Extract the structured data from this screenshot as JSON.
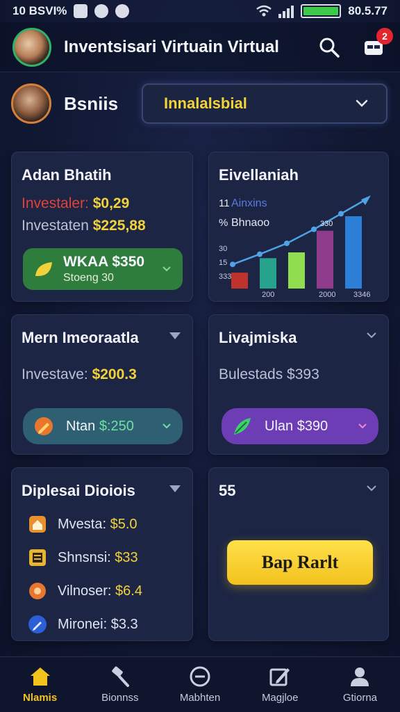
{
  "status_bar": {
    "left_text": "10 BSVI%",
    "time": "80.5.77"
  },
  "header": {
    "title": "Inventsisari Virtuain Virtual",
    "notification_count": "2"
  },
  "profile": {
    "name": "Bsniis",
    "dropdown_value": "Innalalsbial"
  },
  "card_investment": {
    "title": "Adan Bhatih",
    "line1_label": "Investaler:",
    "line1_value": "$0,29",
    "line2_label": "Investaten",
    "line2_value": "$225,88",
    "pill_main": "WKAA $350",
    "pill_sub": "Stoeng 30"
  },
  "card_chart": {
    "title": "Eivellaniah"
  },
  "chart_data": {
    "type": "bar",
    "title": "Eivellaniah",
    "legend": [
      "Ainxins",
      "Bhnaoo"
    ],
    "legend_prefixes": [
      "11",
      "%"
    ],
    "y_ticks": [
      "30",
      "15",
      "333"
    ],
    "x_ticks": [
      "200",
      "2000",
      "3346"
    ],
    "annotation": "330",
    "values": [
      22,
      42,
      50,
      80,
      100
    ],
    "colors": [
      "#c0322d",
      "#27a38d",
      "#90dd4f",
      "#8d3b8a",
      "#2c7fd6"
    ],
    "trend": [
      15,
      28,
      42,
      60,
      80,
      100
    ]
  },
  "card_mern": {
    "title": "Mern Imeoraatla",
    "line_label": "Investave:",
    "line_value": "$200.3",
    "pill_label": "Ntan",
    "pill_value": "$:250"
  },
  "card_liva": {
    "title": "Livajmiska",
    "line_text": "Bulestads $393",
    "pill_label": "Ulan $390"
  },
  "card_diplesai": {
    "title": "Diplesai Dioiois",
    "items": [
      {
        "label": "Mvesta:",
        "value": "$5.0",
        "icon": "house-icon",
        "color": "#e8912e"
      },
      {
        "label": "Shnsnsi:",
        "value": "$33",
        "icon": "document-icon",
        "color": "#e8b52e"
      },
      {
        "label": "Vilnoser:",
        "value": "$6.4",
        "icon": "piggy-bank-icon",
        "color": "#e8762e"
      },
      {
        "label": "Mironei:",
        "value": "$3.3",
        "icon": "pen-icon",
        "color": "#2a5fd6"
      }
    ]
  },
  "card_action": {
    "title": "55",
    "button_label": "Bap Rarlt"
  },
  "bottom_nav": {
    "items": [
      {
        "label": "Nlamis",
        "icon": "home-icon"
      },
      {
        "label": "Bionnss",
        "icon": "gavel-icon"
      },
      {
        "label": "Mabhten",
        "icon": "compass-icon"
      },
      {
        "label": "Magjloe",
        "icon": "edit-icon"
      },
      {
        "label": "Gtiorna",
        "icon": "user-icon"
      }
    ]
  }
}
